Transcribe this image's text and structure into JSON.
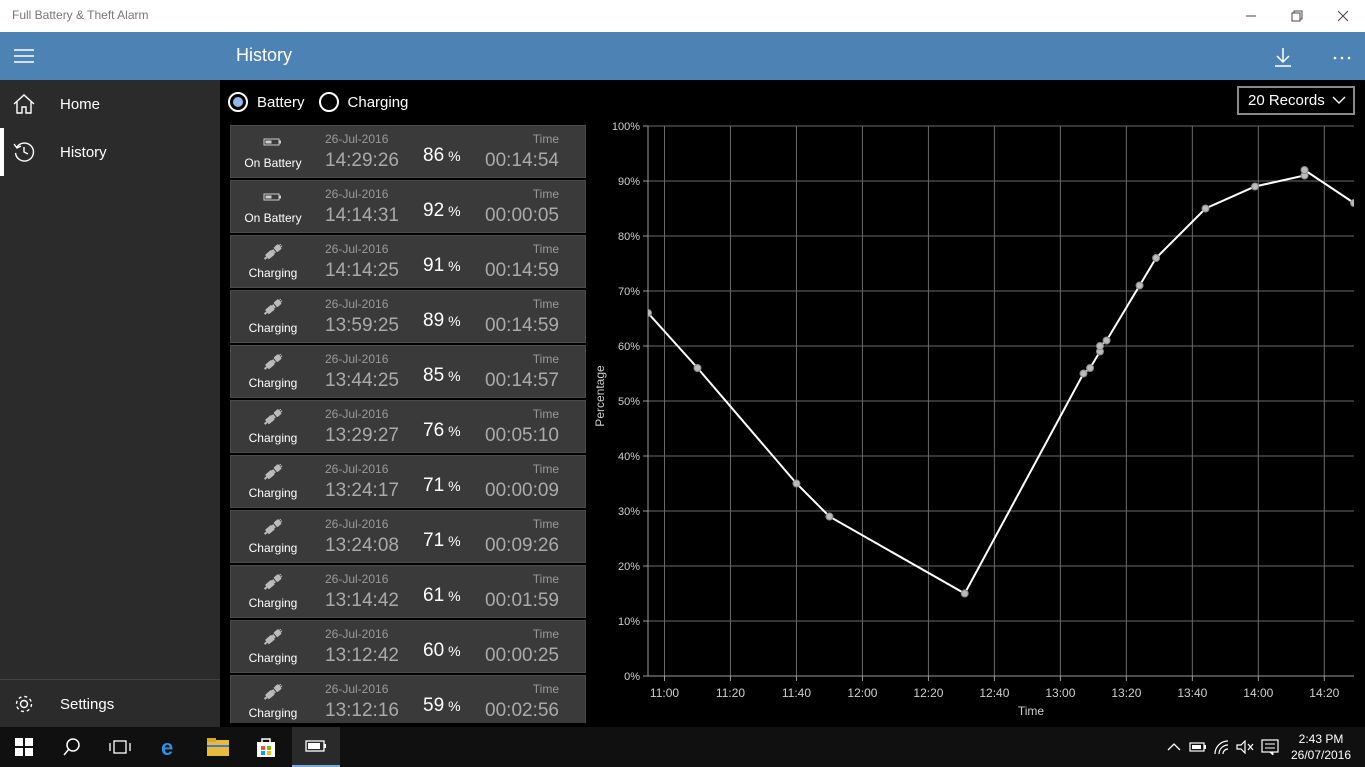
{
  "window": {
    "title": "Full Battery & Theft Alarm"
  },
  "header": {
    "title": "History"
  },
  "sidebar": {
    "items": [
      {
        "label": "Home",
        "icon": "home-icon"
      },
      {
        "label": "History",
        "icon": "history-icon",
        "selected": true
      },
      {
        "label": "Settings",
        "icon": "gear-icon"
      }
    ]
  },
  "filter": {
    "options": [
      {
        "label": "Battery",
        "selected": true
      },
      {
        "label": "Charging",
        "selected": false
      }
    ]
  },
  "records_dropdown": {
    "value": "20 Records"
  },
  "records": [
    {
      "state": "On Battery",
      "date": "26-Jul-2016",
      "time": "14:29:26",
      "percent": "86",
      "duration_label": "Time",
      "duration": "00:14:54"
    },
    {
      "state": "On Battery",
      "date": "26-Jul-2016",
      "time": "14:14:31",
      "percent": "92",
      "duration_label": "Time",
      "duration": "00:00:05"
    },
    {
      "state": "Charging",
      "date": "26-Jul-2016",
      "time": "14:14:25",
      "percent": "91",
      "duration_label": "Time",
      "duration": "00:14:59"
    },
    {
      "state": "Charging",
      "date": "26-Jul-2016",
      "time": "13:59:25",
      "percent": "89",
      "duration_label": "Time",
      "duration": "00:14:59"
    },
    {
      "state": "Charging",
      "date": "26-Jul-2016",
      "time": "13:44:25",
      "percent": "85",
      "duration_label": "Time",
      "duration": "00:14:57"
    },
    {
      "state": "Charging",
      "date": "26-Jul-2016",
      "time": "13:29:27",
      "percent": "76",
      "duration_label": "Time",
      "duration": "00:05:10"
    },
    {
      "state": "Charging",
      "date": "26-Jul-2016",
      "time": "13:24:17",
      "percent": "71",
      "duration_label": "Time",
      "duration": "00:00:09"
    },
    {
      "state": "Charging",
      "date": "26-Jul-2016",
      "time": "13:24:08",
      "percent": "71",
      "duration_label": "Time",
      "duration": "00:09:26"
    },
    {
      "state": "Charging",
      "date": "26-Jul-2016",
      "time": "13:14:42",
      "percent": "61",
      "duration_label": "Time",
      "duration": "00:01:59"
    },
    {
      "state": "Charging",
      "date": "26-Jul-2016",
      "time": "13:12:42",
      "percent": "60",
      "duration_label": "Time",
      "duration": "00:00:25"
    },
    {
      "state": "Charging",
      "date": "26-Jul-2016",
      "time": "13:12:16",
      "percent": "59",
      "duration_label": "Time",
      "duration": "00:02:56"
    }
  ],
  "percent_sign": "%",
  "chart_data": {
    "type": "line",
    "xlabel": "Time",
    "ylabel": "Percentage",
    "x_tick_labels": [
      "11:00",
      "11:20",
      "11:40",
      "12:00",
      "12:20",
      "12:40",
      "13:00",
      "13:20",
      "13:40",
      "14:00",
      "14:20"
    ],
    "y_tick_labels": [
      "0%",
      "10%",
      "20%",
      "30%",
      "40%",
      "50%",
      "60%",
      "70%",
      "80%",
      "90%",
      "100%"
    ],
    "xlim_minutes": [
      "10:55",
      "14:29"
    ],
    "ylim": [
      0,
      100
    ],
    "grid": true,
    "points": [
      {
        "x": "10:55",
        "y": 66
      },
      {
        "x": "11:10",
        "y": 56
      },
      {
        "x": "11:40",
        "y": 35
      },
      {
        "x": "11:50",
        "y": 29
      },
      {
        "x": "12:31",
        "y": 15
      },
      {
        "x": "13:07",
        "y": 55
      },
      {
        "x": "13:09",
        "y": 56
      },
      {
        "x": "13:12",
        "y": 59
      },
      {
        "x": "13:12",
        "y": 60
      },
      {
        "x": "13:14",
        "y": 61
      },
      {
        "x": "13:24",
        "y": 71
      },
      {
        "x": "13:29",
        "y": 76
      },
      {
        "x": "13:44",
        "y": 85
      },
      {
        "x": "13:59",
        "y": 89
      },
      {
        "x": "14:14",
        "y": 91
      },
      {
        "x": "14:14",
        "y": 92
      },
      {
        "x": "14:29",
        "y": 86
      }
    ],
    "line_color": "#ffffff",
    "point_color": "#bbbbbb"
  },
  "taskbar": {
    "icons": [
      "windows-start-icon",
      "search-icon",
      "task-view-icon",
      "edge-icon",
      "file-explorer-icon",
      "store-icon",
      "battery-app-icon"
    ],
    "tray_icons": [
      "chevron-up-icon",
      "battery-icon",
      "wifi-icon",
      "volume-icon",
      "action-center-icon"
    ],
    "time": "2:43 PM",
    "date": "26/07/2016"
  }
}
